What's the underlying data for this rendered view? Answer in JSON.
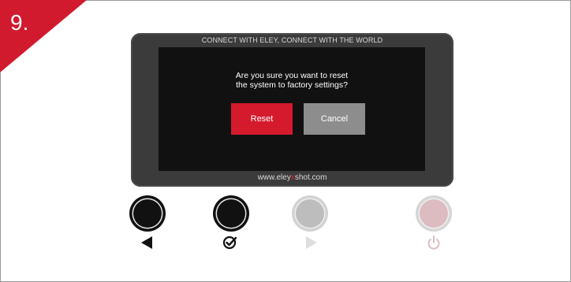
{
  "step": {
    "number": "9."
  },
  "device": {
    "tagline": "CONNECT WITH ELEY, CONNECT WITH THE WORLD",
    "website_prefix": "www.eley",
    "website_accent": "x",
    "website_suffix": "shot.com"
  },
  "dialog": {
    "question_line1": "Are you sure you want to reset",
    "question_line2": "the system to factory settings?",
    "reset_label": "Reset",
    "cancel_label": "Cancel"
  },
  "hardware_buttons": [
    {
      "icon": "left-arrow-icon",
      "state": "active"
    },
    {
      "icon": "check-circle-icon",
      "state": "active"
    },
    {
      "icon": "right-arrow-icon",
      "state": "disabled"
    },
    {
      "icon": "power-icon",
      "state": "disabled"
    }
  ],
  "colors": {
    "accent_red": "#d21a2e",
    "device_body": "#3b3b3b",
    "screen": "#111111",
    "cancel_grey": "#8d8d8d"
  }
}
